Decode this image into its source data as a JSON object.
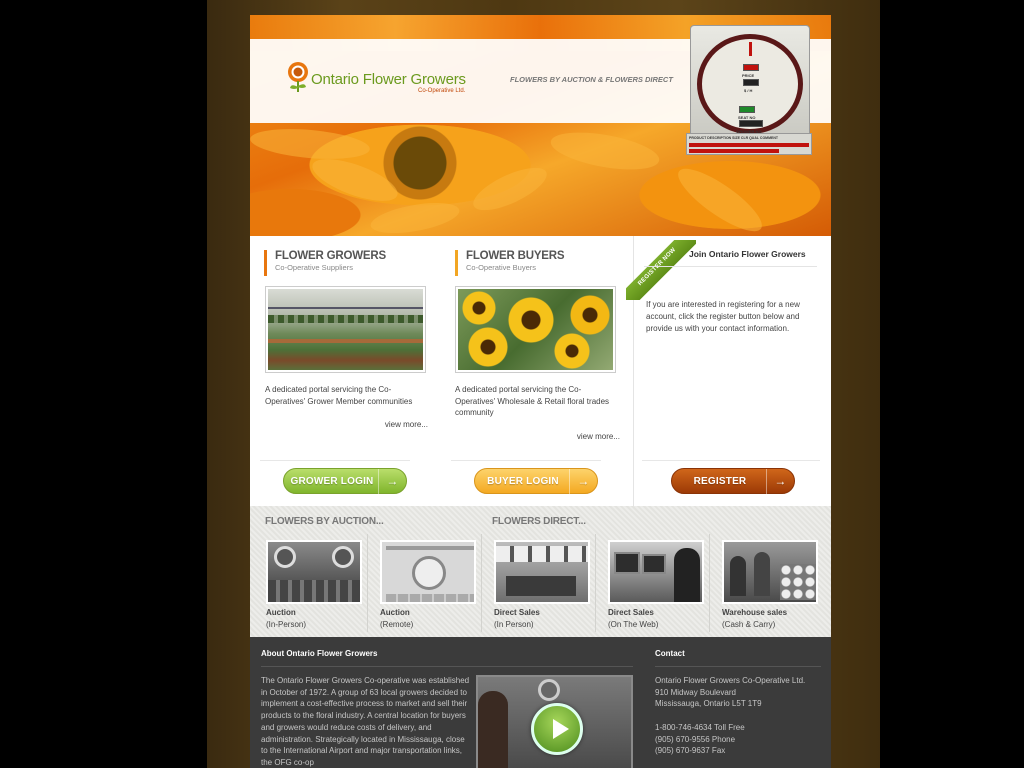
{
  "header": {
    "logo_title": "Ontario Flower Growers",
    "logo_sub": "Co-Operative Ltd.",
    "tagline": "FLOWERS BY AUCTION & FLOWERS DIRECT",
    "clock_labels": [
      "PRICE",
      "$ / H",
      "SEAT NO",
      "GROWER NO"
    ],
    "clock_caption": "PRODUCT DESCRIPTION   SIZE  CLR  QUAL  COMMENT"
  },
  "columns": {
    "growers": {
      "title": "FLOWER GROWERS",
      "subtitle": "Co-Operative Suppliers",
      "description": "A dedicated portal servicing the Co-Operatives' Grower Member communities",
      "more": "view more...",
      "button": "GROWER LOGIN",
      "arrow": "→"
    },
    "buyers": {
      "title": "FLOWER BUYERS",
      "subtitle": "Co-Operative Buyers",
      "description": "A dedicated portal servicing the Co-Operatives' Wholesale & Retail floral trades community",
      "more": "view more...",
      "button": "BUYER LOGIN",
      "arrow": "→"
    },
    "join": {
      "ribbon": "REGISTER NOW",
      "title": "Join Ontario Flower Growers",
      "text": "If you are interested in registering for a new account, click the register button below and provide us with your contact information.",
      "button": "REGISTER",
      "arrow": "→"
    }
  },
  "strip": {
    "auction_head": "FLOWERS BY AUCTION...",
    "direct_head": "FLOWERS DIRECT...",
    "items": [
      {
        "title": "Auction",
        "sub": "(In-Person)"
      },
      {
        "title": "Auction",
        "sub": "(Remote)"
      },
      {
        "title": "Direct Sales",
        "sub": "(In Person)"
      },
      {
        "title": "Direct Sales",
        "sub": "(On The Web)"
      },
      {
        "title": "Warehouse sales",
        "sub": "(Cash & Carry)"
      }
    ]
  },
  "footer": {
    "about_title": "About Ontario Flower Growers",
    "about_text": "The Ontario Flower Growers Co-operative was established in October of 1972. A group of 63 local growers decided to implement a cost-effective process to market and sell their products to the floral industry. A central location for buyers and growers would reduce costs of delivery, and administration. Strategically located in Mississauga, close to the International Airport and major transportation links, the OFG co-op",
    "contact_title": "Contact",
    "contact_lines": [
      "Ontario Flower Growers Co-Operative Ltd.",
      "910 Midway Boulevard",
      "Mississauga, Ontario L5T 1T9",
      "",
      "1-800-746-4634 Toll Free",
      "(905) 670-9556 Phone",
      "(905) 670-9637 Fax"
    ]
  }
}
